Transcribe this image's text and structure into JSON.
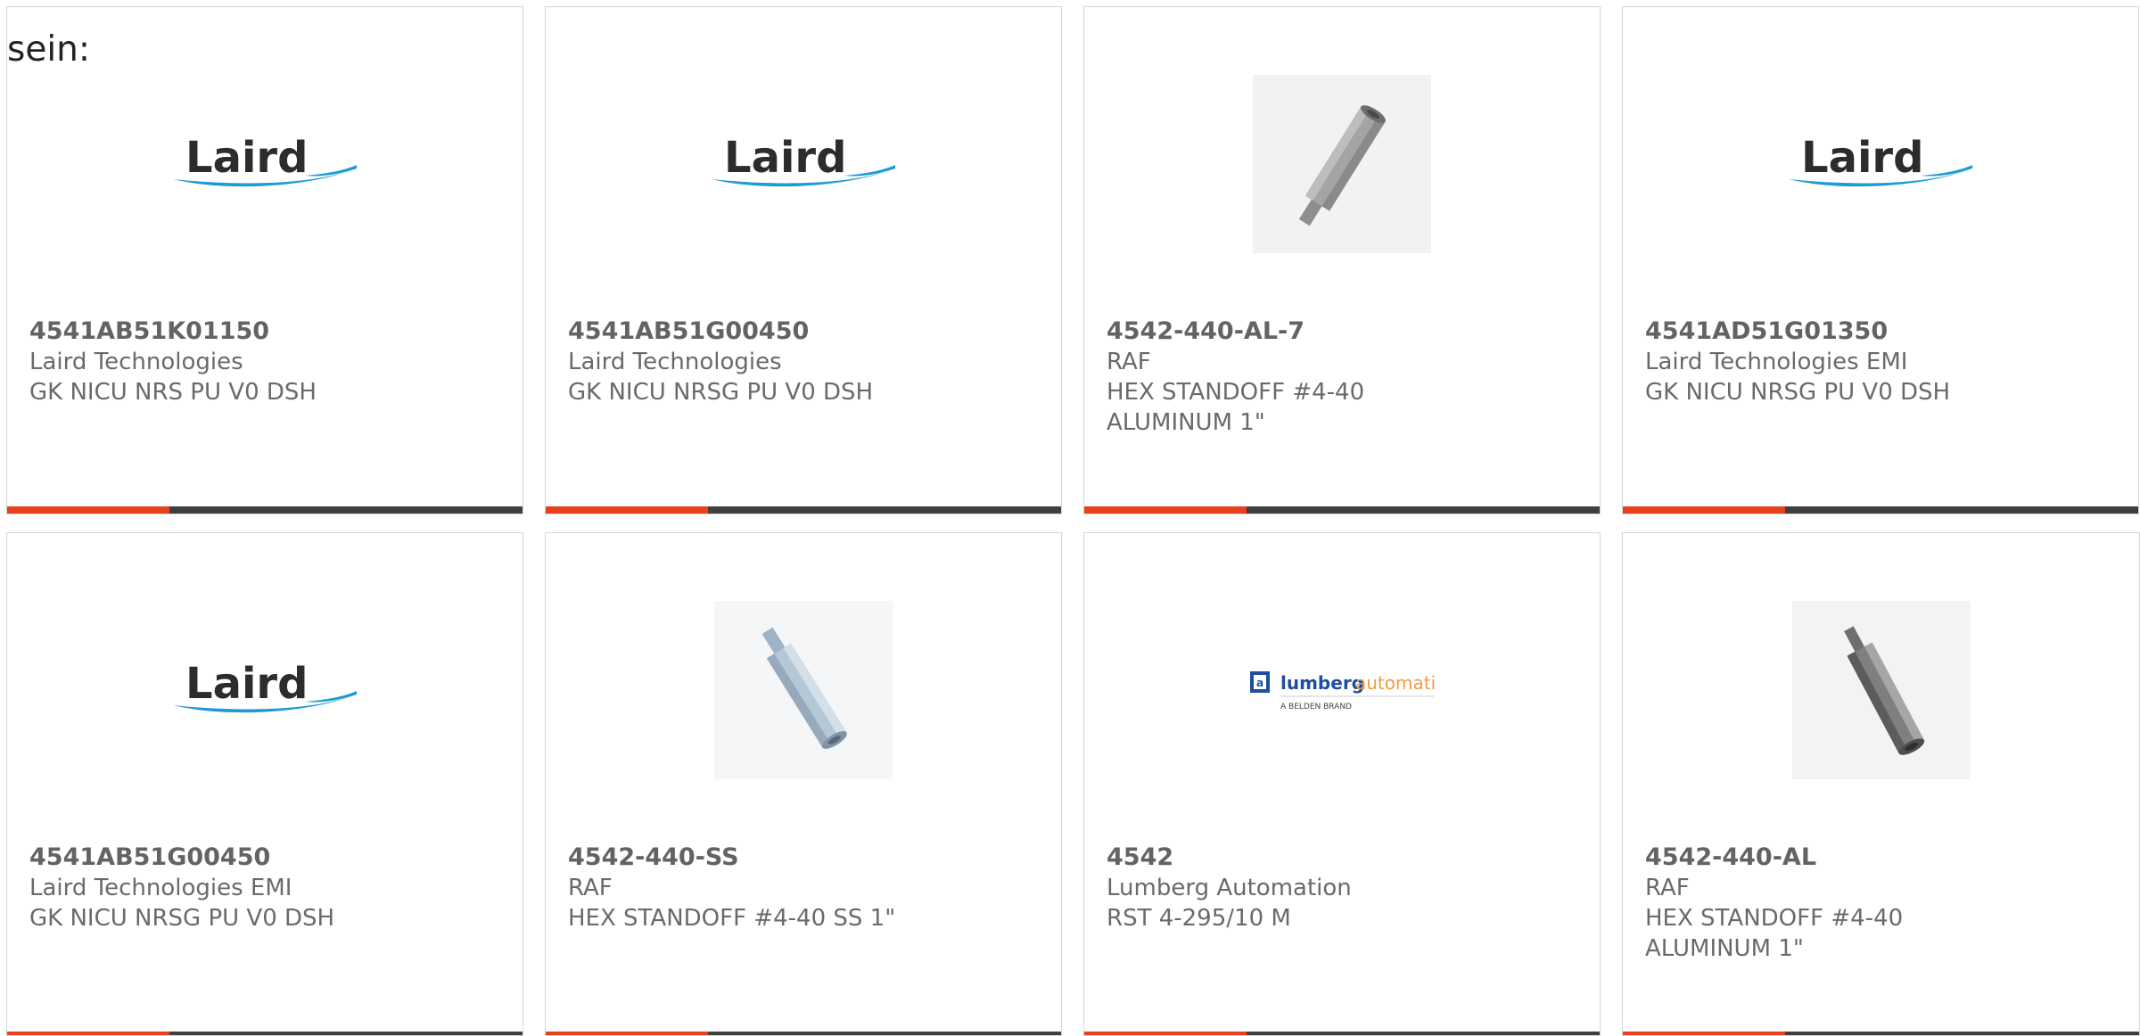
{
  "intro_text": "sein:",
  "cards": [
    {
      "part_number": "4541AB51K01150",
      "manufacturer": "Laird Technologies",
      "desc1": "GK NICU NRS PU V0 DSH",
      "desc2": "",
      "image": "laird-logo"
    },
    {
      "part_number": "4541AB51G00450",
      "manufacturer": "Laird Technologies",
      "desc1": "GK NICU NRSG PU V0 DSH",
      "desc2": "",
      "image": "laird-logo"
    },
    {
      "part_number": "4542-440-AL-7",
      "manufacturer": "RAF",
      "desc1": "HEX STANDOFF #4-40",
      "desc2": "ALUMINUM 1\"",
      "image": "standoff-photo-gray"
    },
    {
      "part_number": "4541AD51G01350",
      "manufacturer": "Laird Technologies EMI",
      "desc1": "GK NICU NRSG PU V0 DSH",
      "desc2": "",
      "image": "laird-logo"
    },
    {
      "part_number": "4541AB51G00450",
      "manufacturer": "Laird Technologies EMI",
      "desc1": "GK NICU NRSG PU V0 DSH",
      "desc2": "",
      "image": "laird-logo"
    },
    {
      "part_number": "4542-440-SS",
      "manufacturer": "RAF",
      "desc1": "HEX STANDOFF #4-40 SS 1\"",
      "desc2": "",
      "image": "standoff-photo-blue"
    },
    {
      "part_number": "4542",
      "manufacturer": "Lumberg Automation",
      "desc1": "RST 4-295/10 M",
      "desc2": "",
      "image": "lumberg-logo"
    },
    {
      "part_number": "4542-440-AL",
      "manufacturer": "RAF",
      "desc1": "HEX STANDOFF #4-40",
      "desc2": "ALUMINUM 1\"",
      "image": "standoff-photo-dark"
    }
  ],
  "logos": {
    "laird_word": "Laird",
    "lumberg_word_a": "lumberg",
    "lumberg_word_b": "automation",
    "lumberg_tagline": "A BELDEN BRAND"
  },
  "colors": {
    "accent": "#e8401c",
    "bar": "#3f3f3f",
    "laird_swoosh": "#1e9ad6",
    "lumberg_blue": "#1f4e9e",
    "lumberg_orange": "#f39c3c"
  }
}
